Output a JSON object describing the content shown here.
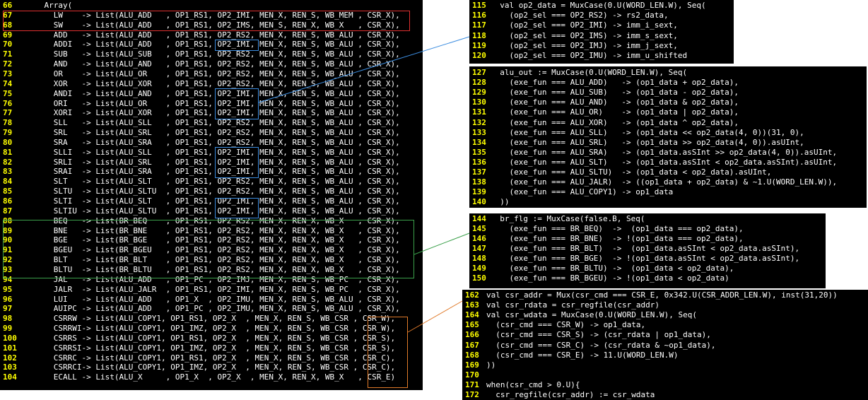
{
  "colors": {
    "background": "#000000",
    "line_number": "#ffff00",
    "code": "#ffffff",
    "keyword": "#ffff00",
    "arrow": "#5b9bd5",
    "red_box": "#e03030",
    "blue_box": "#3c8de0",
    "green_box": "#3aa04a",
    "orange_box": "#e07a2a"
  },
  "left_panel": {
    "lines": [
      {
        "n": "66",
        "code": "    Array("
      },
      {
        "n": "67",
        "code": "      LW    -> List(ALU_ADD   , OP1_RS1, OP2_IMI, MEN_X, REN_S, WB_MEM , CSR_X),"
      },
      {
        "n": "68",
        "code": "      SW    -> List(ALU_ADD   , OP1_RS1, OP2_IMS, MEN_S, REN_X, WB_X   , CSR_X),"
      },
      {
        "n": "69",
        "code": "      ADD   -> List(ALU_ADD   , OP1_RS1, OP2_RS2, MEN_X, REN_S, WB_ALU , CSR_X),"
      },
      {
        "n": "70",
        "code": "      ADDI  -> List(ALU_ADD   , OP1_RS1, OP2_IMI, MEN_X, REN_S, WB_ALU , CSR_X),"
      },
      {
        "n": "71",
        "code": "      SUB   -> List(ALU_SUB   , OP1_RS1, OP2_RS2, MEN_X, REN_S, WB_ALU , CSR_X),"
      },
      {
        "n": "72",
        "code": "      AND   -> List(ALU_AND   , OP1_RS1, OP2_RS2, MEN_X, REN_S, WB_ALU , CSR_X),"
      },
      {
        "n": "73",
        "code": "      OR    -> List(ALU_OR    , OP1_RS1, OP2_RS2, MEN_X, REN_S, WB_ALU , CSR_X),"
      },
      {
        "n": "74",
        "code": "      XOR   -> List(ALU_XOR   , OP1_RS1, OP2_RS2, MEN_X, REN_S, WB_ALU , CSR_X),"
      },
      {
        "n": "75",
        "code": "      ANDI  -> List(ALU_AND   , OP1_RS1, OP2_IMI, MEN_X, REN_S, WB_ALU , CSR_X),"
      },
      {
        "n": "76",
        "code": "      ORI   -> List(ALU_OR    , OP1_RS1, OP2_IMI, MEN_X, REN_S, WB_ALU , CSR_X),"
      },
      {
        "n": "77",
        "code": "      XORI  -> List(ALU_XOR   , OP1_RS1, OP2_IMI, MEN_X, REN_S, WB_ALU , CSR_X),"
      },
      {
        "n": "78",
        "code": "      SLL   -> List(ALU_SLL   , OP1_RS1, OP2_RS2, MEN_X, REN_S, WB_ALU , CSR_X),"
      },
      {
        "n": "79",
        "code": "      SRL   -> List(ALU_SRL   , OP1_RS1, OP2_RS2, MEN_X, REN_S, WB_ALU , CSR_X),"
      },
      {
        "n": "80",
        "code": "      SRA   -> List(ALU_SRA   , OP1_RS1, OP2_RS2, MEN_X, REN_S, WB_ALU , CSR_X),"
      },
      {
        "n": "81",
        "code": "      SLLI  -> List(ALU_SLL   , OP1_RS1, OP2_IMI, MEN_X, REN_S, WB_ALU , CSR_X),"
      },
      {
        "n": "82",
        "code": "      SRLI  -> List(ALU_SRL   , OP1_RS1, OP2_IMI, MEN_X, REN_S, WB_ALU , CSR_X),"
      },
      {
        "n": "83",
        "code": "      SRAI  -> List(ALU_SRA   , OP1_RS1, OP2_IMI, MEN_X, REN_S, WB_ALU , CSR_X),"
      },
      {
        "n": "84",
        "code": "      SLT   -> List(ALU_SLT   , OP1_RS1, OP2_RS2, MEN_X, REN_S, WB_ALU , CSR_X),"
      },
      {
        "n": "85",
        "code": "      SLTU  -> List(ALU_SLTU  , OP1_RS1, OP2_RS2, MEN_X, REN_S, WB_ALU , CSR_X),"
      },
      {
        "n": "86",
        "code": "      SLTI  -> List(ALU_SLT   , OP1_RS1, OP2_IMI, MEN_X, REN_S, WB_ALU , CSR_X),"
      },
      {
        "n": "87",
        "code": "      SLTIU -> List(ALU_SLTU  , OP1_RS1, OP2_IMI, MEN_X, REN_S, WB_ALU , CSR_X),"
      },
      {
        "n": "88",
        "code": "      BEQ   -> List(BR_BEQ    , OP1_RS1, OP2_RS2, MEN_X, REN_X, WB_X   , CSR_X),"
      },
      {
        "n": "89",
        "code": "      BNE   -> List(BR_BNE    , OP1_RS1, OP2_RS2, MEN_X, REN_X, WB_X   , CSR_X),"
      },
      {
        "n": "90",
        "code": "      BGE   -> List(BR_BGE    , OP1_RS1, OP2_RS2, MEN_X, REN_X, WB_X   , CSR_X),"
      },
      {
        "n": "91",
        "code": "      BGEU  -> List(BR_BGEU   , OP1_RS1, OP2_RS2, MEN_X, REN_X, WB_X   , CSR_X),"
      },
      {
        "n": "92",
        "code": "      BLT   -> List(BR_BLT    , OP1_RS1, OP2_RS2, MEN_X, REN_X, WB_X   , CSR_X),"
      },
      {
        "n": "93",
        "code": "      BLTU  -> List(BR_BLTU   , OP1_RS1, OP2_RS2, MEN_X, REN_X, WB_X   , CSR_X),"
      },
      {
        "n": "94",
        "code": "      JAL   -> List(ALU_ADD   , OP1_PC , OP2_IMJ, MEN_X, REN_S, WB_PC  , CSR_X),"
      },
      {
        "n": "95",
        "code": "      JALR  -> List(ALU_JALR  , OP1_RS1, OP2_IMI, MEN_X, REN_S, WB_PC  , CSR_X),"
      },
      {
        "n": "96",
        "code": "      LUI   -> List(ALU_ADD   , OP1_X  , OP2_IMU, MEN_X, REN_S, WB_ALU , CSR_X),"
      },
      {
        "n": "97",
        "code": "      AUIPC -> List(ALU_ADD   , OP1_PC , OP2_IMU, MEN_X, REN_S, WB_ALU , CSR_X),"
      },
      {
        "n": "98",
        "code": "      CSRRW -> List(ALU_COPY1, OP1_RS1, OP2_X  , MEN_X, REN_S, WB_CSR , CSR_W),"
      },
      {
        "n": "99",
        "code": "      CSRRWI-> List(ALU_COPY1, OP1_IMZ, OP2_X  , MEN_X, REN_S, WB_CSR , CSR_W),"
      },
      {
        "n": "100",
        "code": "      CSRRS -> List(ALU_COPY1, OP1_RS1, OP2_X  , MEN_X, REN_S, WB_CSR , CSR_S),"
      },
      {
        "n": "101",
        "code": "      CSRRSI-> List(ALU_COPY1, OP1_IMZ, OP2_X  , MEN_X, REN_S, WB_CSR , CSR_S),"
      },
      {
        "n": "102",
        "code": "      CSRRC -> List(ALU_COPY1, OP1_RS1, OP2_X  , MEN_X, REN_S, WB_CSR , CSR_C),"
      },
      {
        "n": "103",
        "code": "      CSRRCI-> List(ALU_COPY1, OP1_IMZ, OP2_X  , MEN_X, REN_S, WB_CSR , CSR_C),"
      },
      {
        "n": "104",
        "code": "      ECALL -> List(ALU_X     , OP1_X  , OP2_X  , MEN_X, REN_X, WB_X   , CSR_E)"
      }
    ]
  },
  "panel_op2": {
    "lines": [
      {
        "n": "115",
        "code": "  val op2_data = MuxCase(0.U(WORD_LEN.W), Seq("
      },
      {
        "n": "116",
        "code": "    (op2_sel === OP2_RS2) -> rs2_data,"
      },
      {
        "n": "117",
        "code": "    (op2_sel === OP2_IMI) -> imm_i_sext,"
      },
      {
        "n": "118",
        "code": "    (op2_sel === OP2_IMS) -> imm_s_sext,"
      },
      {
        "n": "119",
        "code": "    (op2_sel === OP2_IMJ) -> imm_j_sext,"
      },
      {
        "n": "120",
        "code": "    (op2_sel === OP2_IMU) -> imm_u_shifted"
      }
    ]
  },
  "panel_alu": {
    "lines": [
      {
        "n": "127",
        "code": "  alu_out := MuxCase(0.U(WORD_LEN.W), Seq("
      },
      {
        "n": "128",
        "code": "    (exe_fun === ALU_ADD)   -> (op1_data + op2_data),"
      },
      {
        "n": "129",
        "code": "    (exe_fun === ALU_SUB)   -> (op1_data - op2_data),"
      },
      {
        "n": "130",
        "code": "    (exe_fun === ALU_AND)   -> (op1_data & op2_data),"
      },
      {
        "n": "131",
        "code": "    (exe_fun === ALU_OR)    -> (op1_data | op2_data),"
      },
      {
        "n": "132",
        "code": "    (exe_fun === ALU_XOR)   -> (op1_data ^ op2_data),"
      },
      {
        "n": "133",
        "code": "    (exe_fun === ALU_SLL)   -> (op1_data << op2_data(4, 0))(31, 0),"
      },
      {
        "n": "134",
        "code": "    (exe_fun === ALU_SRL)   -> (op1_data >> op2_data(4, 0)).asUInt,"
      },
      {
        "n": "135",
        "code": "    (exe_fun === ALU_SRA)   -> (op1_data.asSInt >> op2_data(4, 0)).asUInt,"
      },
      {
        "n": "136",
        "code": "    (exe_fun === ALU_SLT)   -> (op1_data.asSInt < op2_data.asSInt).asUInt,"
      },
      {
        "n": "137",
        "code": "    (exe_fun === ALU_SLTU)  -> (op1_data < op2_data).asUInt,"
      },
      {
        "n": "138",
        "code": "    (exe_fun === ALU_JALR)  -> ((op1_data + op2_data) & ~1.U(WORD_LEN.W)),"
      },
      {
        "n": "139",
        "code": "    (exe_fun === ALU_COPY1) -> op1_data"
      },
      {
        "n": "140",
        "code": "  ))"
      }
    ]
  },
  "panel_br": {
    "lines": [
      {
        "n": "144",
        "code": "  br_flg := MuxCase(false.B, Seq("
      },
      {
        "n": "145",
        "code": "    (exe_fun === BR_BEQ)  ->  (op1_data === op2_data),"
      },
      {
        "n": "146",
        "code": "    (exe_fun === BR_BNE)  -> !(op1_data === op2_data),"
      },
      {
        "n": "147",
        "code": "    (exe_fun === BR_BLT)  ->  (op1_data.asSInt < op2_data.asSInt),"
      },
      {
        "n": "148",
        "code": "    (exe_fun === BR_BGE)  -> !(op1_data.asSInt < op2_data.asSInt),"
      },
      {
        "n": "149",
        "code": "    (exe_fun === BR_BLTU) ->  (op1_data < op2_data),"
      },
      {
        "n": "150",
        "code": "    (exe_fun === BR_BGEU) -> !(op1_data < op2_data)"
      }
    ]
  },
  "panel_csr": {
    "lines": [
      {
        "n": "162",
        "code": "val csr_addr = Mux(csr_cmd === CSR_E, 0x342.U(CSR_ADDR_LEN.W), inst(31,20))"
      },
      {
        "n": "163",
        "code": "val csr_rdata = csr_regfile(csr_addr)"
      },
      {
        "n": "164",
        "code": "val csr_wdata = MuxCase(0.U(WORD_LEN.W), Seq("
      },
      {
        "n": "165",
        "code": "  (csr_cmd === CSR_W) -> op1_data,"
      },
      {
        "n": "166",
        "code": "  (csr_cmd === CSR_S) -> (csr_rdata | op1_data),"
      },
      {
        "n": "167",
        "code": "  (csr_cmd === CSR_C) -> (csr_rdata & ~op1_data),"
      },
      {
        "n": "168",
        "code": "  (csr_cmd === CSR_E) -> 11.U(WORD_LEN.W)"
      },
      {
        "n": "169",
        "code": "))"
      },
      {
        "n": "170",
        "code": ""
      },
      {
        "n": "171",
        "code": "when(csr_cmd > 0.U){"
      },
      {
        "n": "172",
        "code": "  csr_regfile(csr_addr) := csr_wdata"
      }
    ]
  }
}
